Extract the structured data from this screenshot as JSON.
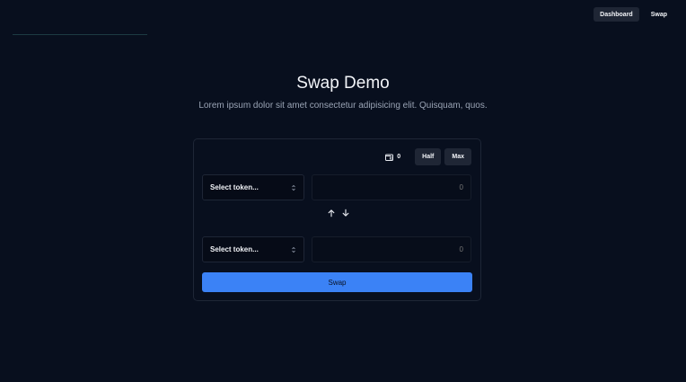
{
  "nav": {
    "items": [
      {
        "label": "Dashboard",
        "active": true
      },
      {
        "label": "Swap",
        "active": false
      }
    ]
  },
  "hero": {
    "title": "Swap Demo",
    "subtitle": "Lorem ipsum dolor sit amet consectetur adipisicing elit. Quisquam, quos."
  },
  "swap": {
    "balance": "0",
    "half_label": "Half",
    "max_label": "Max",
    "from": {
      "select_label": "Select token...",
      "amount_placeholder": "0"
    },
    "to": {
      "select_label": "Select token...",
      "amount_placeholder": "0"
    },
    "submit_label": "Swap",
    "icons": [
      "wallet-icon",
      "chevrons-up-down-icon",
      "arrow-up-icon",
      "arrow-down-icon"
    ]
  },
  "colors": {
    "background": "#080f1e",
    "card_border": "#1e2636",
    "accent": "#3b82f6",
    "muted_button": "#1f2635"
  }
}
